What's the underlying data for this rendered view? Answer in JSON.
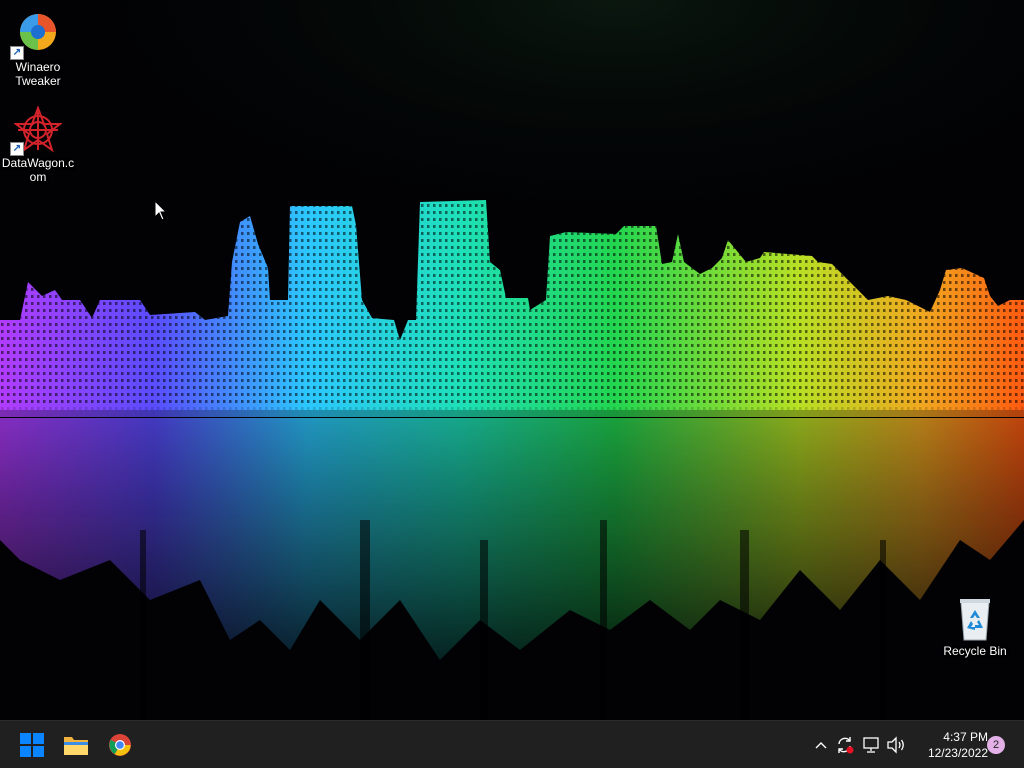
{
  "desktop": {
    "icons": [
      {
        "label": "Winaero Tweaker",
        "icon": "winaero-tweaker-icon",
        "shortcut": true
      },
      {
        "label": "DataWagon.com",
        "icon": "datawagon-icon",
        "shortcut": true
      },
      {
        "label": "Recycle Bin",
        "icon": "recycle-bin-icon",
        "shortcut": false
      }
    ],
    "wallpaper": "city-skyline-rainbow-reflection"
  },
  "taskbar": {
    "pinned": [
      {
        "name": "Start",
        "icon": "windows-start-icon"
      },
      {
        "name": "File Explorer",
        "icon": "folder-icon"
      },
      {
        "name": "Google Chrome",
        "icon": "chrome-icon"
      }
    ],
    "tray": {
      "icons": [
        "chevron-up-icon",
        "sync-alert-icon",
        "network-icon",
        "volume-icon"
      ],
      "time": "4:37 PM",
      "date": "12/23/2022",
      "notification_count": "2"
    }
  },
  "colors": {
    "taskbar_bg": "#202020",
    "windows_blue": "#0a84ff",
    "badge": "#e3b1e8",
    "alert_red": "#e81123"
  }
}
